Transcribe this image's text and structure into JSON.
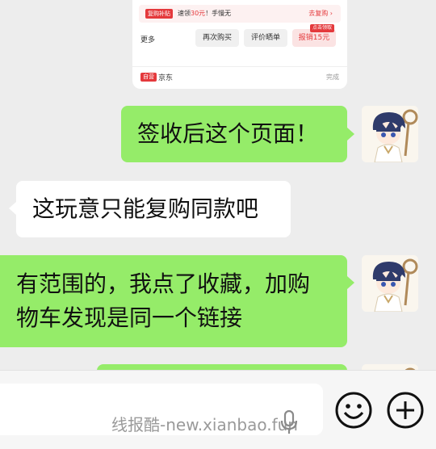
{
  "order_card": {
    "promo_tag": "复购补贴",
    "promo_prefix": "速领",
    "promo_amount": "30元",
    "promo_suffix": "！手慢无",
    "promo_link": "去复购 ›",
    "more_label": "更多",
    "buttons": [
      "再次购买",
      "评价晒单",
      "报销15元"
    ],
    "claim_badge": "点击领取",
    "self_tag": "自营",
    "shop_name": "京东",
    "status": "完成"
  },
  "messages": [
    {
      "side": "me",
      "lines": [
        "签收后这个页面！"
      ]
    },
    {
      "side": "them",
      "lines": [
        "这玩意只能复购同款吧"
      ]
    },
    {
      "side": "me",
      "lines": [
        "有范围的，我点了收藏，加购",
        "物车发现是同一个链接"
      ]
    }
  ],
  "input_bar": {
    "watermark": "线报酷-new.xianbao.fun",
    "icons": [
      "microphone-icon",
      "emoji-icon",
      "plus-icon"
    ]
  },
  "colors": {
    "me_bubble": "#95ec69",
    "them_bubble": "#ffffff",
    "background": "#ededed",
    "accent_red": "#e4393c"
  }
}
